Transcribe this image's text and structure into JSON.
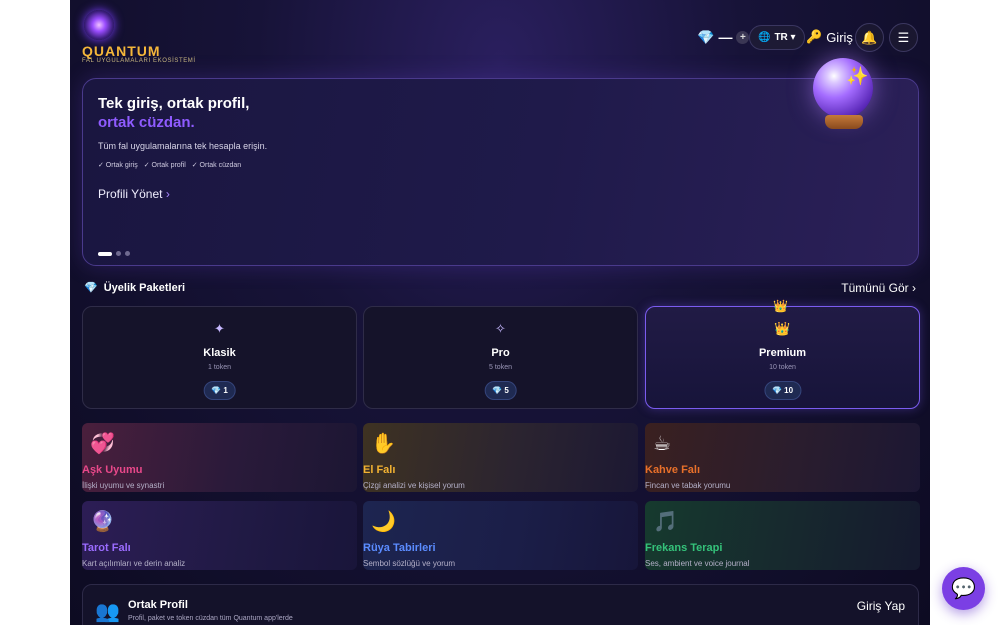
{
  "brand": {
    "title": "QUANTUM",
    "subtitle": "FAL UYGULAMALARI EKOSİSTEMİ",
    "logo_icon": "crystal-orb-icon"
  },
  "header": {
    "wallet_icon": "💎",
    "wallet_value": "—",
    "wallet_add": "+",
    "lang_icon": "🌐",
    "lang_label": "TR ▾",
    "login_icon": "🔑",
    "login_label": "Giriş",
    "bell_icon": "🔔",
    "menu_icon": "☰"
  },
  "hero": {
    "title_line1": "Tek giriş, ortak profil,",
    "title_line2": "ortak cüzdan.",
    "description": "Tüm fal uygulamalarına tek hesapla erişin.",
    "checks": [
      "✓ Ortak giriş",
      "✓ Ortak profil",
      "✓ Ortak cüzdan"
    ],
    "cta_label": "Profili Yönet",
    "cta_chevron": "›",
    "ball_star": "✨",
    "slides_total": 3,
    "slide_active": 1,
    "accent_color": "#8f5bff"
  },
  "packages": {
    "section_icon": "💎",
    "section_title": "Üyelik Paketleri",
    "see_all": "Tümünü Gör ›",
    "crown_top": "👑",
    "items": [
      {
        "icon": "✦",
        "name": "Klasik",
        "tokens": "1 token",
        "badge_icon": "💎",
        "badge_value": "1"
      },
      {
        "icon": "✧",
        "name": "Pro",
        "tokens": "5 token",
        "badge_icon": "💎",
        "badge_value": "5"
      },
      {
        "icon": "👑",
        "name": "Premium",
        "tokens": "10 token",
        "badge_icon": "💎",
        "badge_value": "10"
      }
    ]
  },
  "apps": [
    {
      "icon": "💞",
      "name": "Aşk Uyumu",
      "desc": "İlişki uyumu ve synastri",
      "color": "#e8488a"
    },
    {
      "icon": "✋",
      "name": "El Falı",
      "desc": "Çizgi analizi ve kişisel yorum",
      "color": "#f2b233"
    },
    {
      "icon": "☕",
      "name": "Kahve Falı",
      "desc": "Fincan ve tabak yorumu",
      "color": "#e8702a"
    },
    {
      "icon": "🔮",
      "name": "Tarot Falı",
      "desc": "Kart açılımları ve derin analiz",
      "color": "#9b6cff"
    },
    {
      "icon": "🌙",
      "name": "Rüya Tabirleri",
      "desc": "Sembol sözlüğü ve yorum",
      "color": "#5b8cff"
    },
    {
      "icon": "🎵",
      "name": "Frekans Terapi",
      "desc": "Ses, ambient ve voice journal",
      "color": "#34c27a"
    }
  ],
  "profile_card": {
    "icon": "👥",
    "title": "Ortak Profil",
    "desc": "Profil, paket ve token cüzdan tüm Quantum app'lerde",
    "login_label": "Giriş Yap"
  },
  "chat": {
    "icon": "💬"
  }
}
